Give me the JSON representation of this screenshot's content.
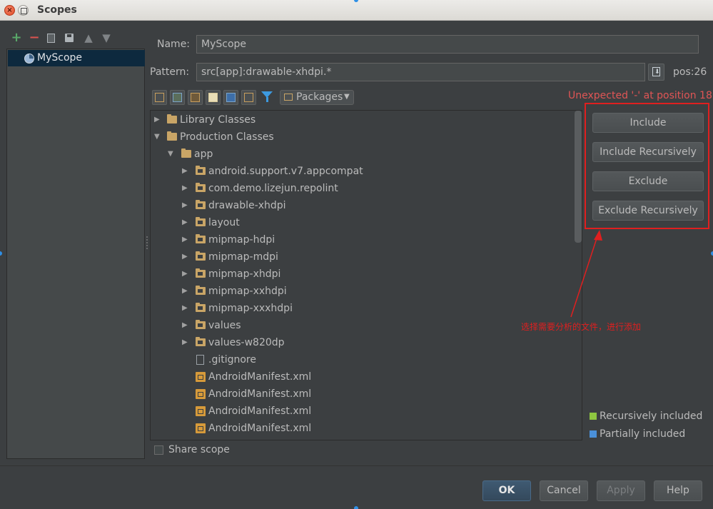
{
  "window": {
    "title": "Scopes"
  },
  "scopes": {
    "items": [
      {
        "label": "MyScope"
      }
    ]
  },
  "form": {
    "name_label": "Name:",
    "name_value": "MyScope",
    "pattern_label": "Pattern:",
    "pattern_value": "src[app]:drawable-xhdpi.*",
    "pos_label": "pos:26"
  },
  "view_selector": {
    "selected": "Packages"
  },
  "error_message": "Unexpected '-' at position 18",
  "tree": {
    "rows": [
      {
        "label": "Library Classes"
      },
      {
        "label": "Production Classes"
      },
      {
        "label": "app"
      },
      {
        "label": "android.support.v7.appcompat"
      },
      {
        "label": "com.demo.lizejun.repolint"
      },
      {
        "label": "drawable-xhdpi"
      },
      {
        "label": "layout"
      },
      {
        "label": "mipmap-hdpi"
      },
      {
        "label": "mipmap-mdpi"
      },
      {
        "label": "mipmap-xhdpi"
      },
      {
        "label": "mipmap-xxhdpi"
      },
      {
        "label": "mipmap-xxxhdpi"
      },
      {
        "label": "values"
      },
      {
        "label": "values-w820dp"
      },
      {
        "label": ".gitignore"
      },
      {
        "label": "AndroidManifest.xml"
      },
      {
        "label": "AndroidManifest.xml"
      },
      {
        "label": "AndroidManifest.xml"
      },
      {
        "label": "AndroidManifest.xml"
      }
    ]
  },
  "actions": {
    "include": "Include",
    "include_recursively": "Include Recursively",
    "exclude": "Exclude",
    "exclude_recursively": "Exclude Recursively"
  },
  "annotation": {
    "text": "选择需要分析的文件，进行添加",
    "color": "#e01f1f"
  },
  "legend": {
    "recursively_included": "Recursively included",
    "partially_included": "Partially included",
    "recursive_color": "#8ec640",
    "partial_color": "#4a90d9"
  },
  "share_scope": {
    "label": "Share scope",
    "checked": false
  },
  "dialog_buttons": {
    "ok": "OK",
    "cancel": "Cancel",
    "apply": "Apply",
    "help": "Help"
  }
}
